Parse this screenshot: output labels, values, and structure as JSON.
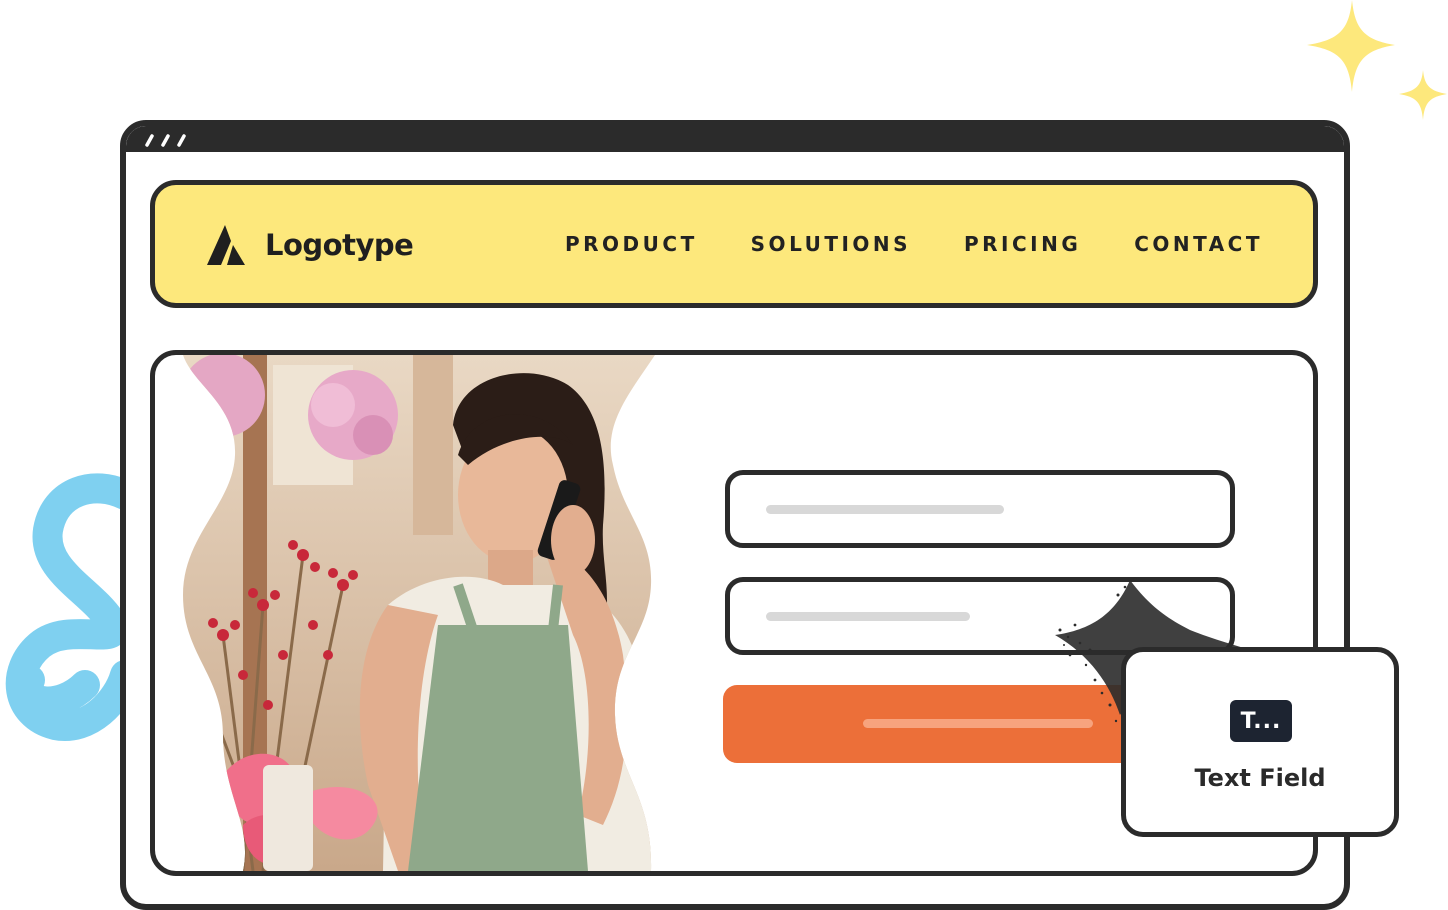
{
  "brand": {
    "logo_text": "Logotype",
    "logo_icon": "logo-mark-icon"
  },
  "nav": {
    "items": [
      {
        "label": "PRODUCT"
      },
      {
        "label": "SOLUTIONS"
      },
      {
        "label": "PRICING"
      },
      {
        "label": "CONTACT"
      }
    ]
  },
  "hero": {
    "image": "florist-on-phone-photo"
  },
  "form": {
    "fields": [
      {
        "name": "field-1",
        "value": ""
      },
      {
        "name": "field-2",
        "value": ""
      }
    ],
    "submit_label": ""
  },
  "tooltip": {
    "icon_text": "T...",
    "label": "Text Field"
  },
  "colors": {
    "navbar_bg": "#fde87c",
    "accent_button": "#ec6f39",
    "outline": "#2b2b2b",
    "sparkle": "#fde87c",
    "squiggle": "#7fd0f0",
    "tooltip_icon_bg": "#1d2431"
  }
}
